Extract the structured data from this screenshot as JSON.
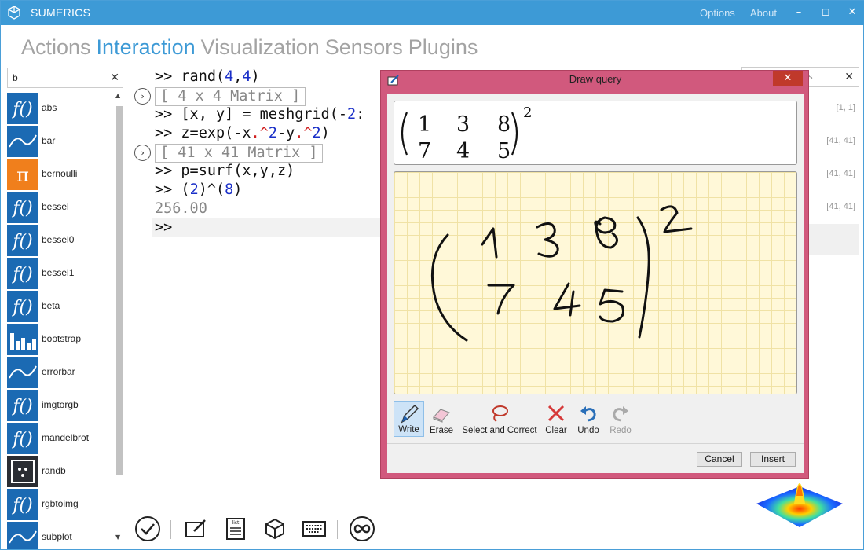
{
  "app": {
    "title": "SUMERICS",
    "options_label": "Options",
    "about_label": "About",
    "minimize": "–",
    "maximize": "◻",
    "close": "✕"
  },
  "tabs": [
    "Actions",
    "Interaction",
    "Visualization",
    "Sensors",
    "Plugins"
  ],
  "active_tab": "Interaction",
  "search": {
    "value": "b",
    "clear": "✕"
  },
  "functions": [
    {
      "label": "abs",
      "icon": "function-icon"
    },
    {
      "label": "bar",
      "icon": "line-plot-icon"
    },
    {
      "label": "bernoulli",
      "icon": "pi-icon"
    },
    {
      "label": "bessel",
      "icon": "function-icon"
    },
    {
      "label": "bessel0",
      "icon": "function-icon"
    },
    {
      "label": "bessel1",
      "icon": "function-icon"
    },
    {
      "label": "beta",
      "icon": "function-icon"
    },
    {
      "label": "bootstrap",
      "icon": "bar-chart-icon"
    },
    {
      "label": "errorbar",
      "icon": "line-plot-icon"
    },
    {
      "label": "imgtorgb",
      "icon": "function-icon"
    },
    {
      "label": "mandelbrot",
      "icon": "function-icon"
    },
    {
      "label": "randb",
      "icon": "dice-icon"
    },
    {
      "label": "rgbtoimg",
      "icon": "function-icon"
    },
    {
      "label": "subplot",
      "icon": "line-plot-icon"
    }
  ],
  "console": {
    "prompt": ">>",
    "line1": {
      "a": "rand(",
      "n1": "4",
      "c": ",",
      "n2": "4",
      "d": ")"
    },
    "out1": "[ 4 x 4 Matrix ]",
    "line2": {
      "a": "[x, y] = meshgrid(-",
      "n1": "2",
      "b": ":"
    },
    "line3": {
      "a": "z=exp(-x",
      "r1": ".^",
      "n1": "2",
      "b": "-y",
      "r2": ".^",
      "n2": "2",
      "c": ")"
    },
    "out2": "[ 41 x 41 Matrix ]",
    "line4": "p=surf(x,y,z)",
    "line5": {
      "a": "(",
      "n1": "2",
      "b": ")^(",
      "n2": "8",
      "c": ")"
    },
    "result": "256.00",
    "expand_icon": "›"
  },
  "right_panel": {
    "search_placeholder": "s",
    "clear": "✕",
    "values": [
      "[1, 1]",
      "[41, 41]",
      "[41, 41]",
      "[41, 41]"
    ]
  },
  "dialog": {
    "title": "Draw query",
    "close": "✕",
    "preview": {
      "row1": [
        "1",
        "3",
        "8"
      ],
      "row2": [
        "7",
        "4",
        "5"
      ],
      "exponent": "2"
    },
    "tools": [
      {
        "label": "Write",
        "icon": "pen-icon",
        "selected": true,
        "enabled": true
      },
      {
        "label": "Erase",
        "icon": "eraser-icon",
        "selected": false,
        "enabled": true
      },
      {
        "label": "Select and Correct",
        "icon": "lasso-icon",
        "selected": false,
        "enabled": true
      },
      {
        "label": "Clear",
        "icon": "clear-icon",
        "selected": false,
        "enabled": true
      },
      {
        "label": "Undo",
        "icon": "undo-icon",
        "selected": false,
        "enabled": true
      },
      {
        "label": "Redo",
        "icon": "redo-icon",
        "selected": false,
        "enabled": false
      }
    ],
    "cancel_label": "Cancel",
    "insert_label": "Insert"
  },
  "bottom_toolbar": [
    "check-icon",
    "edit-icon",
    "list-icon",
    "cube-icon",
    "keyboard-icon",
    "infinity-icon"
  ],
  "bottom_toolbar_list_label": "list",
  "colors": {
    "accent": "#3d9ad6",
    "dialog_frame": "#d1597d",
    "function_tile": "#1b6ab3",
    "pi_tile": "#f07f1c"
  }
}
